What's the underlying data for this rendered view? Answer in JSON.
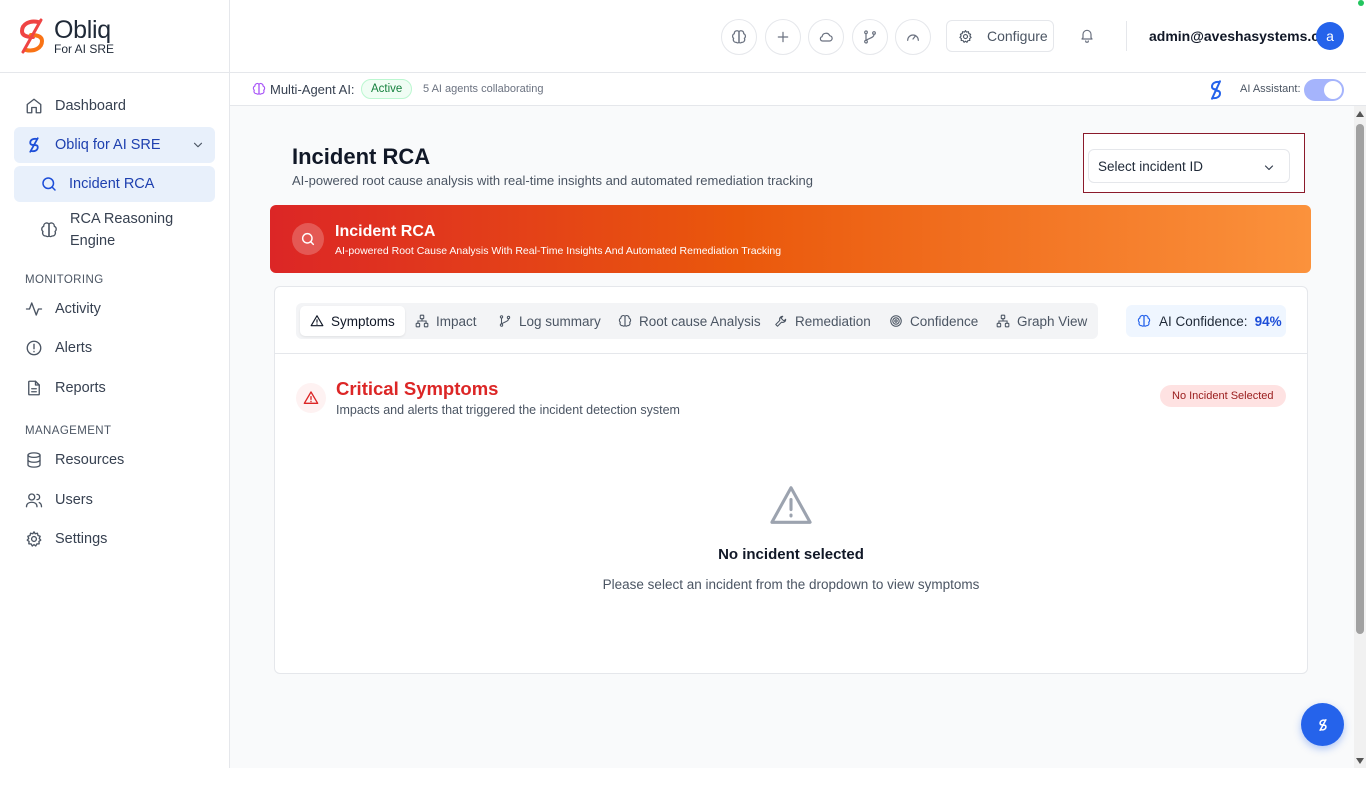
{
  "brand": {
    "name": "Obliq",
    "tagline": "For AI SRE",
    "logo_color_top": "#ef4444",
    "logo_color_bottom": "#f97316"
  },
  "sidebar": {
    "items": [
      {
        "label": "Dashboard",
        "icon": "home-icon"
      },
      {
        "label": "Obliq for AI SRE",
        "icon": "obliq-logo-icon",
        "expanded": true
      },
      {
        "label": "Incident RCA",
        "icon": "search-icon",
        "active": true
      },
      {
        "label": "RCA Reasoning Engine",
        "icon": "brain-icon"
      }
    ],
    "monitoring_title": "MONITORING",
    "monitoring": [
      {
        "label": "Activity",
        "icon": "activity-icon"
      },
      {
        "label": "Alerts",
        "icon": "alert-circle-icon"
      },
      {
        "label": "Reports",
        "icon": "file-text-icon"
      }
    ],
    "management_title": "MANAGEMENT",
    "management": [
      {
        "label": "Resources",
        "icon": "database-icon"
      },
      {
        "label": "Users",
        "icon": "users-icon"
      },
      {
        "label": "Settings",
        "icon": "gear-icon"
      }
    ]
  },
  "topbar": {
    "configure_label": "Configure",
    "user_email": "admin@aveshasystems.com",
    "avatar_letter": "a"
  },
  "statusbar": {
    "label": "Multi-Agent AI:",
    "badge": "Active",
    "agents": "5 AI agents collaborating",
    "assistant_label": "AI Assistant:",
    "assistant_on": true
  },
  "page": {
    "title": "Incident RCA",
    "subtitle": "AI-powered root cause analysis with real-time insights and automated remediation tracking",
    "select_placeholder": "Select incident ID"
  },
  "hero": {
    "title": "Incident RCA",
    "subtitle": "AI-powered Root Cause Analysis With Real-Time Insights And Automated Remediation Tracking"
  },
  "tabs": [
    {
      "label": "Symptoms",
      "icon": "alert-triangle-icon",
      "active": true
    },
    {
      "label": "Impact",
      "icon": "network-icon"
    },
    {
      "label": "Log summary",
      "icon": "git-branch-icon"
    },
    {
      "label": "Root cause Analysis",
      "icon": "brain-icon"
    },
    {
      "label": "Remediation",
      "icon": "wrench-icon"
    },
    {
      "label": "Confidence",
      "icon": "target-icon"
    },
    {
      "label": "Graph View",
      "icon": "network-icon"
    }
  ],
  "confidence": {
    "label": "AI Confidence:",
    "value": "94%"
  },
  "symptoms": {
    "title": "Critical Symptoms",
    "subtitle": "Impacts and alerts that triggered the incident detection system",
    "badge": "No Incident Selected",
    "empty_title": "No incident selected",
    "empty_subtitle": "Please select an incident from the dropdown to view symptoms"
  },
  "colors": {
    "accent": "#2563eb",
    "danger": "#dc2626",
    "active_bg": "#e8f0fb",
    "success": "#15803d"
  }
}
